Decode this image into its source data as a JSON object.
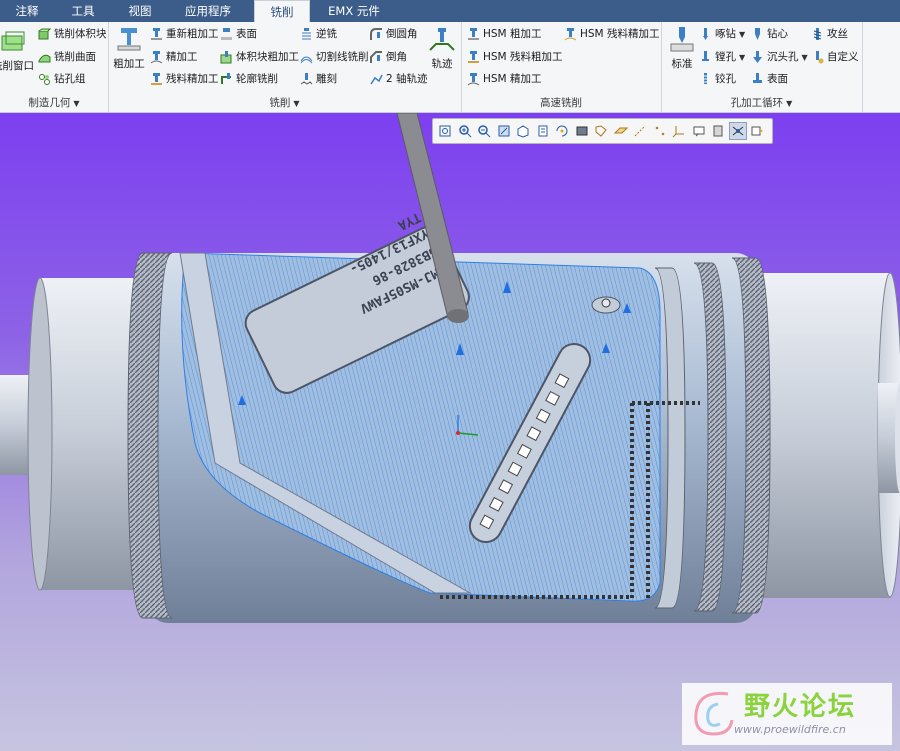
{
  "tabs": [
    {
      "label": "注释",
      "active": false
    },
    {
      "label": "工具",
      "active": false
    },
    {
      "label": "视图",
      "active": false
    },
    {
      "label": "应用程序",
      "active": false
    },
    {
      "label": "铣削",
      "active": true
    },
    {
      "label": "EMX 元件",
      "active": false
    }
  ],
  "ribbon": {
    "manufacturing_geometry": {
      "label": "制造几何",
      "mill_window": "铣削窗口",
      "mill_volume": "铣削体积块",
      "mill_surface": "铣削曲面",
      "drill_group": "钻孔组"
    },
    "milling": {
      "label": "铣削",
      "roughing": "粗加工",
      "re_rough": "重新粗加工",
      "finishing": "精加工",
      "rest_finish": "残料精加工",
      "face": "表面",
      "volume_rough": "体积块粗加工",
      "profile": "轮廓铣削",
      "climb": "逆铣",
      "cutline": "切割线铣削",
      "engrave": "雕刻",
      "round_chamfer": "倒圆角",
      "chamfer": "倒角",
      "two_axis": "2 轴轨迹",
      "trajectory": "轨迹"
    },
    "hsm": {
      "label": "高速铣削",
      "rough": "HSM 粗加工",
      "rest_rough": "HSM 残料粗加工",
      "finish": "HSM 精加工",
      "rest_finish": "HSM 残料精加工"
    },
    "holemaking": {
      "label": "孔加工循环",
      "standard": "标准",
      "peck": "啄钻",
      "bore": "镗孔",
      "ream": "铰孔",
      "center": "钻心",
      "countersink": "沉头孔",
      "face": "表面",
      "tap": "攻丝",
      "custom": "自定义"
    }
  },
  "part_engraving": {
    "line1": "EMJ-MS05FAWV",
    "line2": "GB3828-86",
    "line3": "YXF13/1405-",
    "line4": "TYA"
  },
  "watermark": {
    "title": "野火论坛",
    "url": "www.proewildfire.cn"
  },
  "colors": {
    "tab_bar": "#3c5d8a",
    "ribbon_bg": "#f5f6f8",
    "viewport_top": "#7d3ff0",
    "viewport_bottom": "#c6c5e0",
    "part_blue": "#98b6d8",
    "toolpath": "#2f7fe6",
    "tool_gray": "#8a8c92",
    "watermark_green": "#8ad33c"
  },
  "view_toolbar": {
    "icons": [
      "refit-icon",
      "zoom-in-icon",
      "zoom-out-icon",
      "repaint-icon",
      "view-orient-icon",
      "saved-views-icon",
      "spin-center-icon",
      "display-style-icon",
      "datum-display-icon",
      "plane-display-icon",
      "axis-display-icon",
      "point-display-icon",
      "csys-display-icon",
      "annotation-display-icon",
      "layer-icon",
      "toolpath-display-icon",
      "perspective-icon"
    ]
  }
}
